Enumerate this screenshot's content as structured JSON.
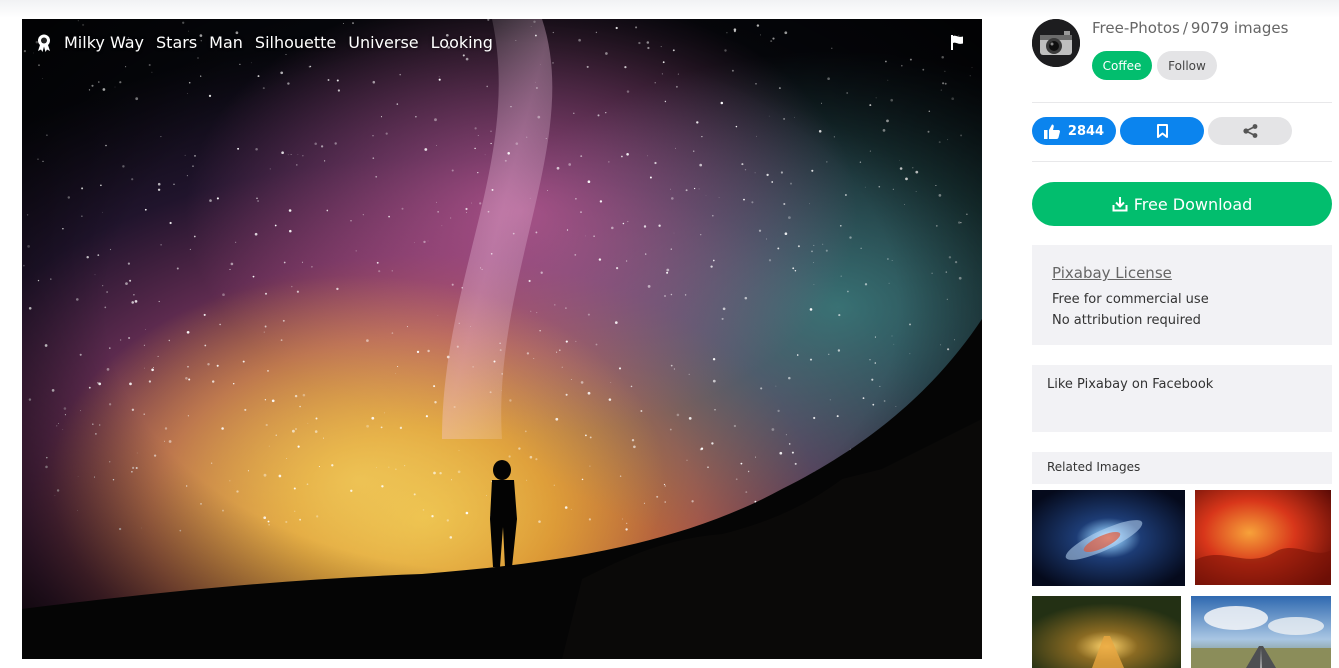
{
  "image": {
    "tags": [
      "Milky Way",
      "Stars",
      "Man",
      "Silhouette",
      "Universe",
      "Looking"
    ],
    "tag_icon": "award-icon",
    "flag_icon": "flag-icon"
  },
  "author": {
    "name": "Free-Photos",
    "separator": "/",
    "image_count": "9079 images",
    "coffee_label": "Coffee",
    "follow_label": "Follow"
  },
  "actions": {
    "like_count": "2844",
    "like_icon": "thumbs-up-icon",
    "collect_icon": "bookmark-icon",
    "share_icon": "share-icon",
    "download_label": "Free Download"
  },
  "license": {
    "title": "Pixabay License",
    "line1": "Free for commercial use",
    "line2": "No attribution required"
  },
  "social": {
    "facebook_text": "Like Pixabay on Facebook"
  },
  "related": {
    "heading": "Related Images"
  },
  "colors": {
    "green": "#02be6e",
    "blue": "#0b84ee",
    "grey_button": "#e4e4e6",
    "panel": "#f2f2f5"
  }
}
